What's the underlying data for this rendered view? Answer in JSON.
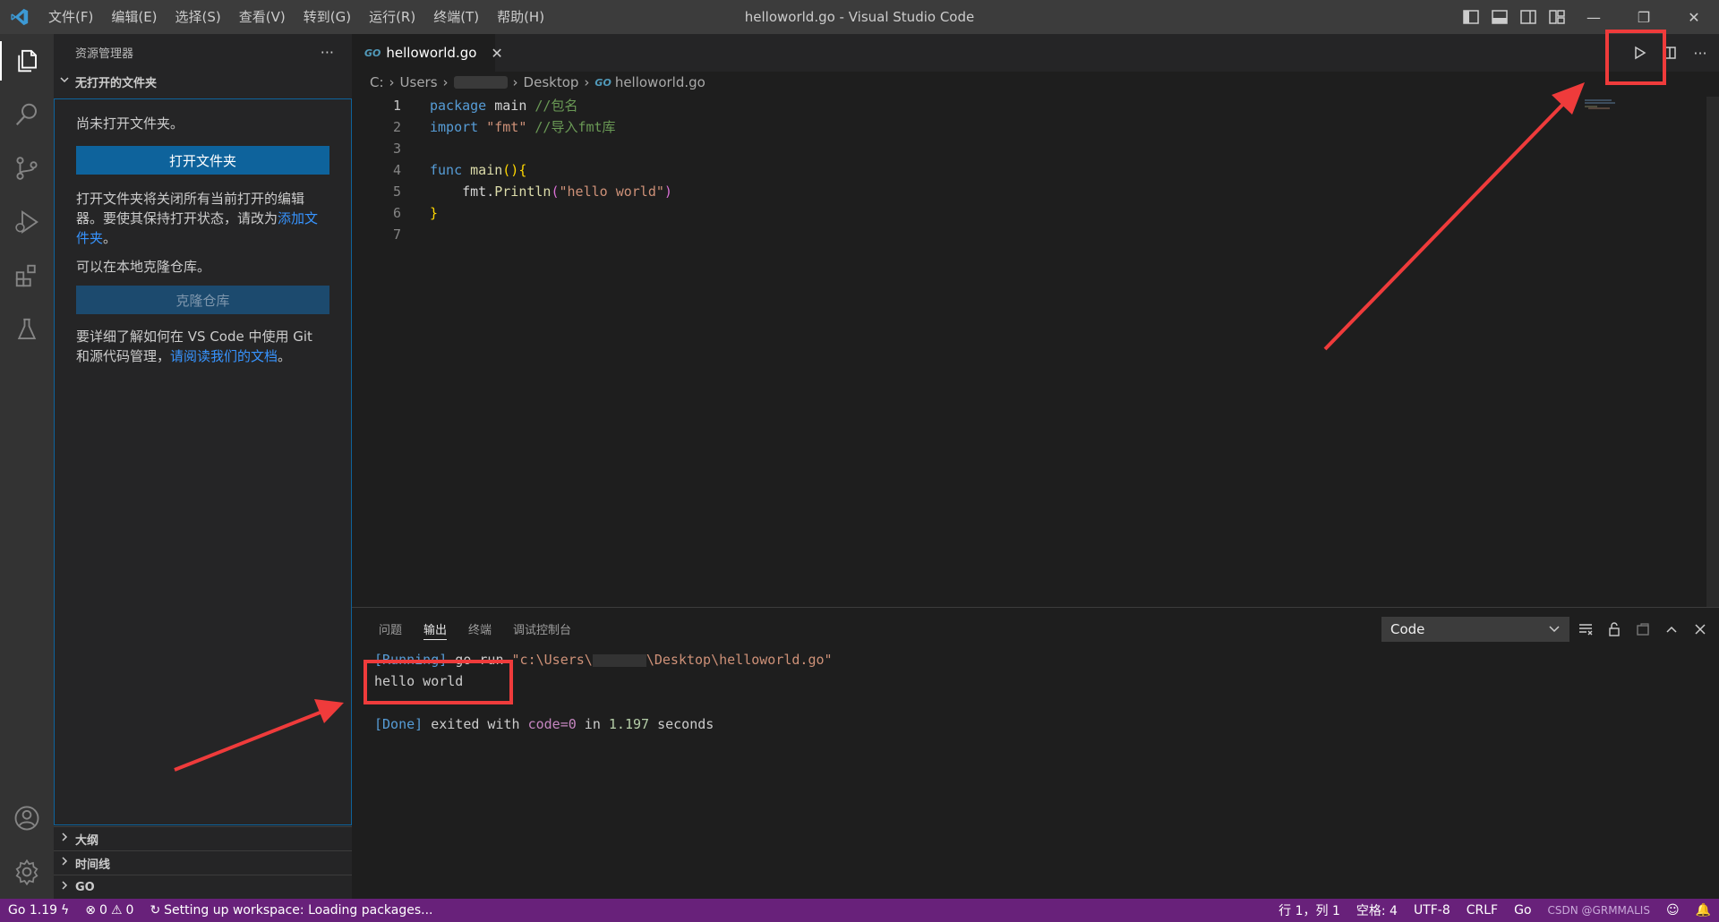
{
  "window": {
    "title": "helloworld.go - Visual Studio Code",
    "menu": [
      "文件(F)",
      "编辑(E)",
      "选择(S)",
      "查看(V)",
      "转到(G)",
      "运行(R)",
      "终端(T)",
      "帮助(H)"
    ]
  },
  "sidebar": {
    "header": "资源管理器",
    "more": "···",
    "section_title": "无打开的文件夹",
    "no_folder_text": "尚未打开文件夹。",
    "open_folder_button": "打开文件夹",
    "open_folder_desc_1": "打开文件夹将关闭所有当前打开的编辑器。要使其保持打开状态，请改为",
    "open_folder_desc_link": "添加文件夹",
    "open_folder_desc_end": "。",
    "clone_text": "可以在本地克隆仓库。",
    "clone_button": "克隆仓库",
    "git_desc": "要详细了解如何在 VS Code 中使用 Git 和源代码管理，",
    "git_link": "请阅读我们的文档",
    "git_end": "。",
    "bottom_sections": [
      "大纲",
      "时间线",
      "GO"
    ]
  },
  "editor": {
    "tab": {
      "icon_text": "GO",
      "label": "helloworld.go",
      "close": "✕"
    },
    "breadcrumb": [
      "C:",
      "Users",
      "Desktop",
      "helloworld.go"
    ],
    "lines": [
      {
        "n": "1",
        "a": "package",
        "b": " main ",
        "c": "//包名"
      },
      {
        "n": "2",
        "a": "import",
        "b": " ",
        "s": "\"fmt\"",
        "c": " //导入fmt库"
      },
      {
        "n": "3"
      },
      {
        "n": "4",
        "a": "func",
        "f": " main",
        "p": "(){"
      },
      {
        "n": "5",
        "x": "    fmt.",
        "f": "Println",
        "q": "(",
        "s": "\"hello world\"",
        "r": ")"
      },
      {
        "n": "6",
        "p": "}"
      },
      {
        "n": "7"
      }
    ]
  },
  "panel": {
    "tabs": [
      "问题",
      "输出",
      "终端",
      "调试控制台"
    ],
    "active_tab": "输出",
    "channel": "Code",
    "output": {
      "running_tag": "[Running]",
      "running_cmd": " go run ",
      "running_path_a": "\"c:\\Users\\",
      "running_path_b": "\\Desktop\\helloworld.go\"",
      "result": "hello world",
      "done_tag": "[Done]",
      "done_a": " exited with ",
      "done_code": "code=0",
      "done_b": " in ",
      "done_num": "1.197",
      "done_c": " seconds"
    }
  },
  "statusbar": {
    "go_version": "Go 1.19",
    "errors": "0",
    "warnings": "0",
    "workspace": "Setting up workspace: Loading packages...",
    "position": "行 1，列 1",
    "spaces": "空格: 4",
    "encoding": "UTF-8",
    "eol": "CRLF",
    "language": "Go",
    "watermark": "CSDN @GRMMALIS"
  },
  "colors": {
    "annotation": "#ef3b3b",
    "statusbar": "#68217a",
    "primary_button": "#0e639c"
  }
}
